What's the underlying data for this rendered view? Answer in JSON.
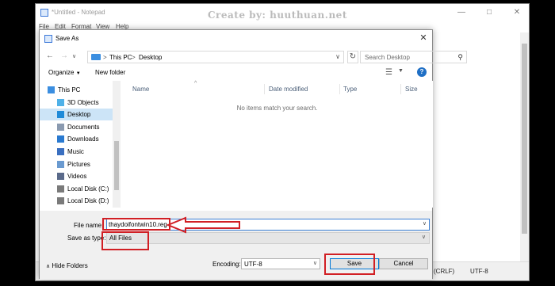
{
  "watermark": "Create by: huuthuan.net",
  "notepad": {
    "title": "*Untitled - Notepad",
    "menu": [
      "File",
      "Edit",
      "Format",
      "View",
      "Help"
    ],
    "status": {
      "line_ending": "(CRLF)",
      "encoding": "UTF-8"
    }
  },
  "dialog": {
    "title": "Save As",
    "address": {
      "segments": [
        "This PC",
        "Desktop"
      ],
      "separator": ">"
    },
    "search_placeholder": "Search Desktop",
    "toolbar": {
      "organize": "Organize",
      "new_folder": "New folder"
    },
    "nav_items": [
      {
        "label": "This PC",
        "icon": "pc-icon",
        "color": "#3b8ee0"
      },
      {
        "label": "3D Objects",
        "icon": "cube-icon",
        "color": "#4fb1e8"
      },
      {
        "label": "Desktop",
        "icon": "desktop-icon",
        "color": "#1f8ad8",
        "selected": true
      },
      {
        "label": "Documents",
        "icon": "documents-icon",
        "color": "#8a9ab0"
      },
      {
        "label": "Downloads",
        "icon": "download-icon",
        "color": "#2a7ad0"
      },
      {
        "label": "Music",
        "icon": "music-icon",
        "color": "#3a6fc0"
      },
      {
        "label": "Pictures",
        "icon": "pictures-icon",
        "color": "#6a9ad0"
      },
      {
        "label": "Videos",
        "icon": "videos-icon",
        "color": "#5a6a8a"
      },
      {
        "label": "Local Disk (C:)",
        "icon": "drive-icon",
        "color": "#7a7a7a"
      },
      {
        "label": "Local Disk (D:)",
        "icon": "drive-icon",
        "color": "#7a7a7a"
      }
    ],
    "columns": [
      "Name",
      "Date modified",
      "Type",
      "Size"
    ],
    "empty_message": "No items match your search.",
    "file_name_label": "File name:",
    "file_name_value": "thaydoifontwin10.reg",
    "save_type_label": "Save as type:",
    "save_type_value": "All Files",
    "hide_folders": "Hide Folders",
    "encoding_label": "Encoding:",
    "encoding_value": "UTF-8",
    "save_button": "Save",
    "cancel_button": "Cancel"
  },
  "colors": {
    "annotation_red": "#d11f24",
    "selection": "#cce4f7",
    "accent": "#0078d7"
  }
}
